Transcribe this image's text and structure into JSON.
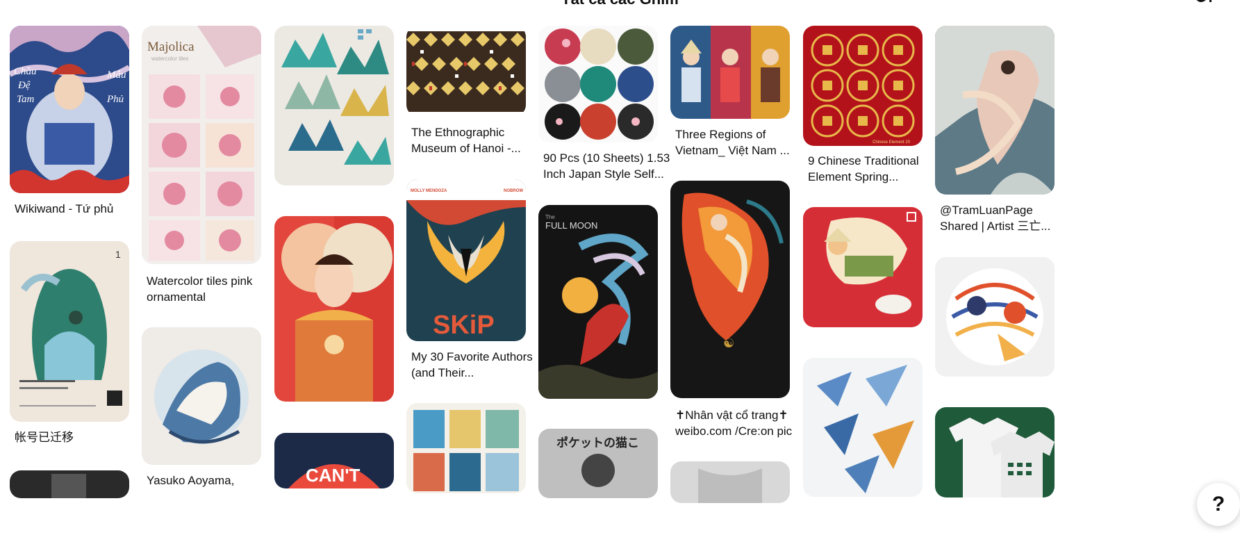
{
  "header": {
    "title": "Tất cả các Ghim"
  },
  "pins": [
    {
      "caption": "Wikiwand - Tứ phủ",
      "art_text": [
        "Chầu",
        "Đệ",
        "Tam",
        "Mẫu",
        "Phủ"
      ]
    },
    {
      "caption": "帐号已迁移",
      "art_text": [
        "1"
      ]
    },
    {
      "caption": "Watercolor tiles pink ornamental",
      "art_text": [
        "Majolica",
        "watercolor tiles"
      ]
    },
    {
      "caption": "Yasuko Aoyama,"
    },
    {
      "caption": ""
    },
    {
      "caption": ""
    },
    {
      "caption": "",
      "art_text": [
        "CAN'T"
      ]
    },
    {
      "caption": "The Ethnographic Museum of Hanoi -..."
    },
    {
      "caption": "My 30 Favorite Authors (and Their...",
      "art_text": [
        "MOLLY MENDOZA",
        "NOBROW",
        "SKiP"
      ]
    },
    {
      "caption": ""
    },
    {
      "caption": "90 Pcs (10 Sheets) 1.53 Inch Japan Style Self..."
    },
    {
      "caption": "",
      "art_text": [
        "The",
        "FULL MOON"
      ]
    },
    {
      "caption": "",
      "art_text": [
        "ポケットの猫こ"
      ]
    },
    {
      "caption": "Three Regions of Vietnam_ Việt Nam ..."
    },
    {
      "caption": "✝Nhân vật cổ trang✝ weibo.com /Cre:on pic"
    },
    {
      "caption": ""
    },
    {
      "caption": "9 Chinese Traditional Element Spring...",
      "art_text": [
        "Chinese Element 20"
      ]
    },
    {
      "caption": ""
    },
    {
      "caption": ""
    },
    {
      "caption": "@TramLuanPage Shared | Artist 三亡..."
    },
    {
      "caption": ""
    },
    {
      "caption": ""
    }
  ],
  "help": {
    "label": "?"
  },
  "colors": {
    "background": "#ffffff",
    "text": "#111111",
    "chinese_red": "#b3121a"
  }
}
